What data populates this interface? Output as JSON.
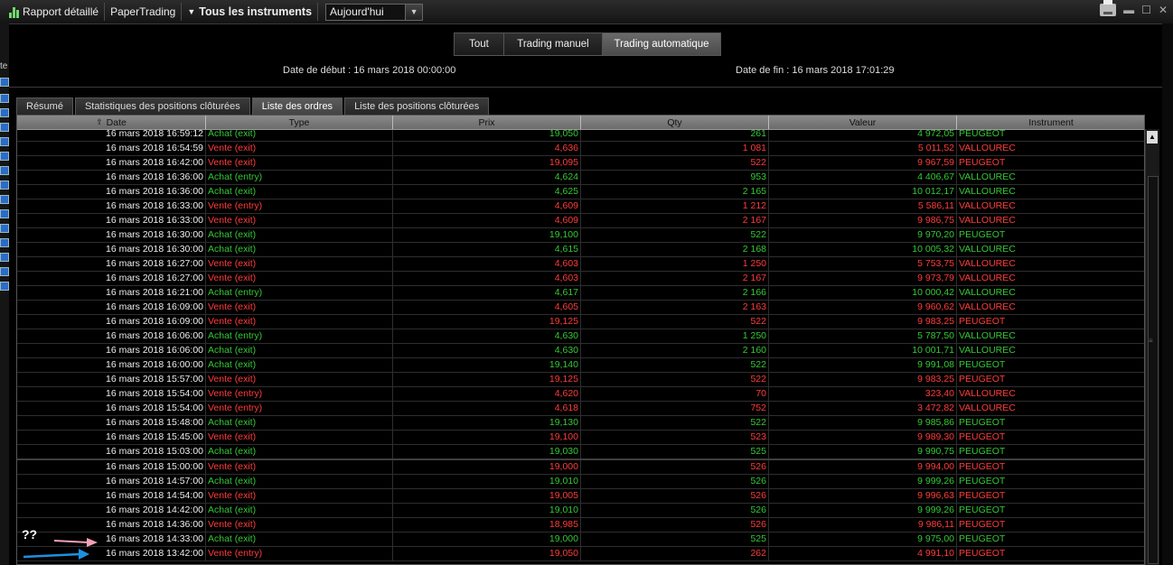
{
  "toolbar": {
    "report_label": "Rapport détaillé",
    "account_label": "PaperTrading",
    "instruments_label": "Tous les instruments",
    "period_value": "Aujourd'hui"
  },
  "modes": [
    {
      "label": "Tout",
      "active": false
    },
    {
      "label": "Trading manuel",
      "active": false
    },
    {
      "label": "Trading automatique",
      "active": true
    }
  ],
  "dates": {
    "start": "Date de début :  16 mars 2018 00:00:00",
    "end": "Date de fin :  16 mars 2018 17:01:29"
  },
  "tabs": [
    {
      "label": "Résumé",
      "active": false
    },
    {
      "label": "Statistiques des positions clôturées",
      "active": false
    },
    {
      "label": "Liste des ordres",
      "active": true
    },
    {
      "label": "Liste des positions clôturées",
      "active": false
    }
  ],
  "columns": [
    "Date",
    "Type",
    "Prix",
    "Qty",
    "Valeur",
    "Instrument"
  ],
  "orders": [
    {
      "date": "16 mars 2018 16:59:12",
      "type": "Achat (exit)",
      "prix": "19,050",
      "qty": "261",
      "valeur": "4 972,05",
      "instrument": "PEUGEOT"
    },
    {
      "date": "16 mars 2018 16:54:59",
      "type": "Vente (exit)",
      "prix": "4,636",
      "qty": "1 081",
      "valeur": "5 011,52",
      "instrument": "VALLOUREC"
    },
    {
      "date": "16 mars 2018 16:42:00",
      "type": "Vente (exit)",
      "prix": "19,095",
      "qty": "522",
      "valeur": "9 967,59",
      "instrument": "PEUGEOT"
    },
    {
      "date": "16 mars 2018 16:36:00",
      "type": "Achat (entry)",
      "prix": "4,624",
      "qty": "953",
      "valeur": "4 406,67",
      "instrument": "VALLOUREC"
    },
    {
      "date": "16 mars 2018 16:36:00",
      "type": "Achat (exit)",
      "prix": "4,625",
      "qty": "2 165",
      "valeur": "10 012,17",
      "instrument": "VALLOUREC"
    },
    {
      "date": "16 mars 2018 16:33:00",
      "type": "Vente (entry)",
      "prix": "4,609",
      "qty": "1 212",
      "valeur": "5 586,11",
      "instrument": "VALLOUREC"
    },
    {
      "date": "16 mars 2018 16:33:00",
      "type": "Vente (exit)",
      "prix": "4,609",
      "qty": "2 167",
      "valeur": "9 986,75",
      "instrument": "VALLOUREC"
    },
    {
      "date": "16 mars 2018 16:30:00",
      "type": "Achat (exit)",
      "prix": "19,100",
      "qty": "522",
      "valeur": "9 970,20",
      "instrument": "PEUGEOT"
    },
    {
      "date": "16 mars 2018 16:30:00",
      "type": "Achat (exit)",
      "prix": "4,615",
      "qty": "2 168",
      "valeur": "10 005,32",
      "instrument": "VALLOUREC"
    },
    {
      "date": "16 mars 2018 16:27:00",
      "type": "Vente (exit)",
      "prix": "4,603",
      "qty": "1 250",
      "valeur": "5 753,75",
      "instrument": "VALLOUREC"
    },
    {
      "date": "16 mars 2018 16:27:00",
      "type": "Vente (exit)",
      "prix": "4,603",
      "qty": "2 167",
      "valeur": "9 973,79",
      "instrument": "VALLOUREC"
    },
    {
      "date": "16 mars 2018 16:21:00",
      "type": "Achat (entry)",
      "prix": "4,617",
      "qty": "2 166",
      "valeur": "10 000,42",
      "instrument": "VALLOUREC"
    },
    {
      "date": "16 mars 2018 16:09:00",
      "type": "Vente (exit)",
      "prix": "4,605",
      "qty": "2 163",
      "valeur": "9 960,62",
      "instrument": "VALLOUREC"
    },
    {
      "date": "16 mars 2018 16:09:00",
      "type": "Vente (exit)",
      "prix": "19,125",
      "qty": "522",
      "valeur": "9 983,25",
      "instrument": "PEUGEOT"
    },
    {
      "date": "16 mars 2018 16:06:00",
      "type": "Achat (entry)",
      "prix": "4,630",
      "qty": "1 250",
      "valeur": "5 787,50",
      "instrument": "VALLOUREC"
    },
    {
      "date": "16 mars 2018 16:06:00",
      "type": "Achat (exit)",
      "prix": "4,630",
      "qty": "2 160",
      "valeur": "10 001,71",
      "instrument": "VALLOUREC"
    },
    {
      "date": "16 mars 2018 16:00:00",
      "type": "Achat (exit)",
      "prix": "19,140",
      "qty": "522",
      "valeur": "9 991,08",
      "instrument": "PEUGEOT"
    },
    {
      "date": "16 mars 2018 15:57:00",
      "type": "Vente (exit)",
      "prix": "19,125",
      "qty": "522",
      "valeur": "9 983,25",
      "instrument": "PEUGEOT"
    },
    {
      "date": "16 mars 2018 15:54:00",
      "type": "Vente (entry)",
      "prix": "4,620",
      "qty": "70",
      "valeur": "323,40",
      "instrument": "VALLOUREC"
    },
    {
      "date": "16 mars 2018 15:54:00",
      "type": "Vente (entry)",
      "prix": "4,618",
      "qty": "752",
      "valeur": "3 472,82",
      "instrument": "VALLOUREC"
    },
    {
      "date": "16 mars 2018 15:48:00",
      "type": "Achat (exit)",
      "prix": "19,130",
      "qty": "522",
      "valeur": "9 985,86",
      "instrument": "PEUGEOT"
    },
    {
      "date": "16 mars 2018 15:45:00",
      "type": "Vente (exit)",
      "prix": "19,100",
      "qty": "523",
      "valeur": "9 989,30",
      "instrument": "PEUGEOT"
    },
    {
      "date": "16 mars 2018 15:03:00",
      "type": "Achat (exit)",
      "prix": "19,030",
      "qty": "525",
      "valeur": "9 990,75",
      "instrument": "PEUGEOT"
    },
    {
      "date": "16 mars 2018 15:00:00",
      "type": "Vente (exit)",
      "prix": "19,000",
      "qty": "526",
      "valeur": "9 994,00",
      "instrument": "PEUGEOT"
    },
    {
      "date": "16 mars 2018 14:57:00",
      "type": "Achat (exit)",
      "prix": "19,010",
      "qty": "526",
      "valeur": "9 999,26",
      "instrument": "PEUGEOT"
    },
    {
      "date": "16 mars 2018 14:54:00",
      "type": "Vente (exit)",
      "prix": "19,005",
      "qty": "526",
      "valeur": "9 996,63",
      "instrument": "PEUGEOT"
    },
    {
      "date": "16 mars 2018 14:42:00",
      "type": "Achat (exit)",
      "prix": "19,010",
      "qty": "526",
      "valeur": "9 999,26",
      "instrument": "PEUGEOT"
    },
    {
      "date": "16 mars 2018 14:36:00",
      "type": "Vente (exit)",
      "prix": "18,985",
      "qty": "526",
      "valeur": "9 986,11",
      "instrument": "PEUGEOT"
    },
    {
      "date": "16 mars 2018 14:33:00",
      "type": "Achat (exit)",
      "prix": "19,000",
      "qty": "525",
      "valeur": "9 975,00",
      "instrument": "PEUGEOT"
    },
    {
      "date": "16 mars 2018 13:42:00",
      "type": "Vente (entry)",
      "prix": "19,050",
      "qty": "262",
      "valeur": "4 991,10",
      "instrument": "PEUGEOT"
    }
  ],
  "annotation": {
    "text": "??"
  },
  "colors": {
    "buy": "#35c835",
    "sell": "#ff3b3b",
    "arrow_pink": "#f4a0b8",
    "arrow_blue": "#1e90e0"
  }
}
